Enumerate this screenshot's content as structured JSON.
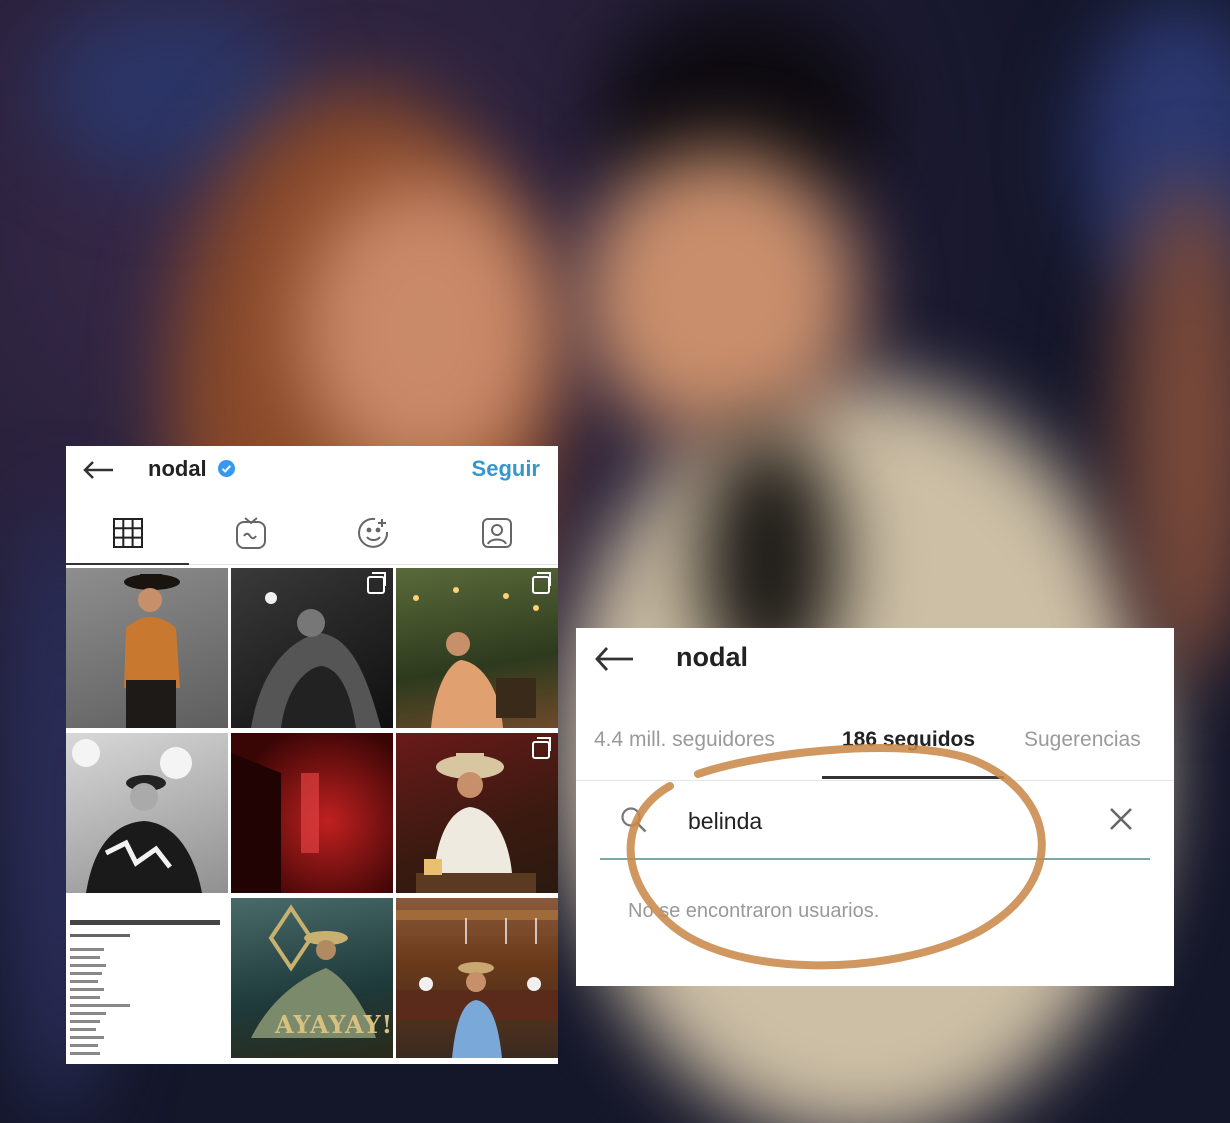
{
  "left_profile": {
    "username": "nodal",
    "follow_label": "Seguir",
    "tabs": [
      "grid-icon",
      "igtv-icon",
      "face-sticker-icon",
      "tagged-icon"
    ],
    "posts": [
      {
        "overlay_text": ""
      },
      {
        "overlay_text": ""
      },
      {
        "overlay_text": ""
      },
      {
        "overlay_text": ""
      },
      {
        "overlay_text": ""
      },
      {
        "overlay_text": ""
      },
      {
        "overlay_text": ""
      },
      {
        "overlay_text": "AYAYAY!"
      },
      {
        "overlay_text": ""
      }
    ]
  },
  "right_following": {
    "username": "nodal",
    "tabs": {
      "followers": "4.4 mill. seguidores",
      "following": "186 seguidos",
      "suggestions": "Sugerencias"
    },
    "search": {
      "value": "belinda"
    },
    "empty_message": "No se encontraron usuarios."
  },
  "colors": {
    "link_blue": "#3897c9",
    "annotation_circle": "#c98a4a"
  }
}
